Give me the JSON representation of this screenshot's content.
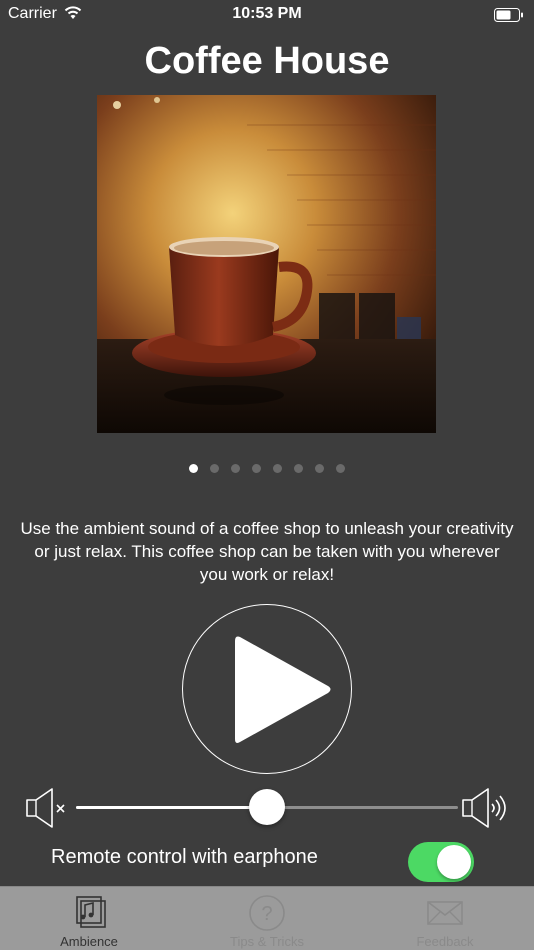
{
  "status_bar": {
    "carrier": "Carrier",
    "time": "10:53 PM"
  },
  "title": "Coffee House",
  "artwork": {
    "icon": "coffee-cup-photo"
  },
  "pagination": {
    "total": 8,
    "current": 1
  },
  "description": "Use the ambient sound of a coffee shop to unleash your creativity or just relax. This coffee shop can be taken with you wherever you work or relax!",
  "player": {
    "play_icon": "play-icon"
  },
  "volume": {
    "level": 0.5,
    "min_icon": "speaker-mute-icon",
    "max_icon": "speaker-loud-icon"
  },
  "remote": {
    "label": "Remote control with earphone",
    "enabled": true
  },
  "tabs": [
    {
      "label": "Ambience",
      "icon": "music-notes-icon",
      "active": true
    },
    {
      "label": "Tips & Tricks",
      "icon": "question-icon",
      "active": false
    },
    {
      "label": "Feedback",
      "icon": "envelope-icon",
      "active": false
    }
  ],
  "colors": {
    "background": "#3d3d3d",
    "toggle_on": "#4cd964",
    "tab_bar": "#9b9b9b"
  }
}
